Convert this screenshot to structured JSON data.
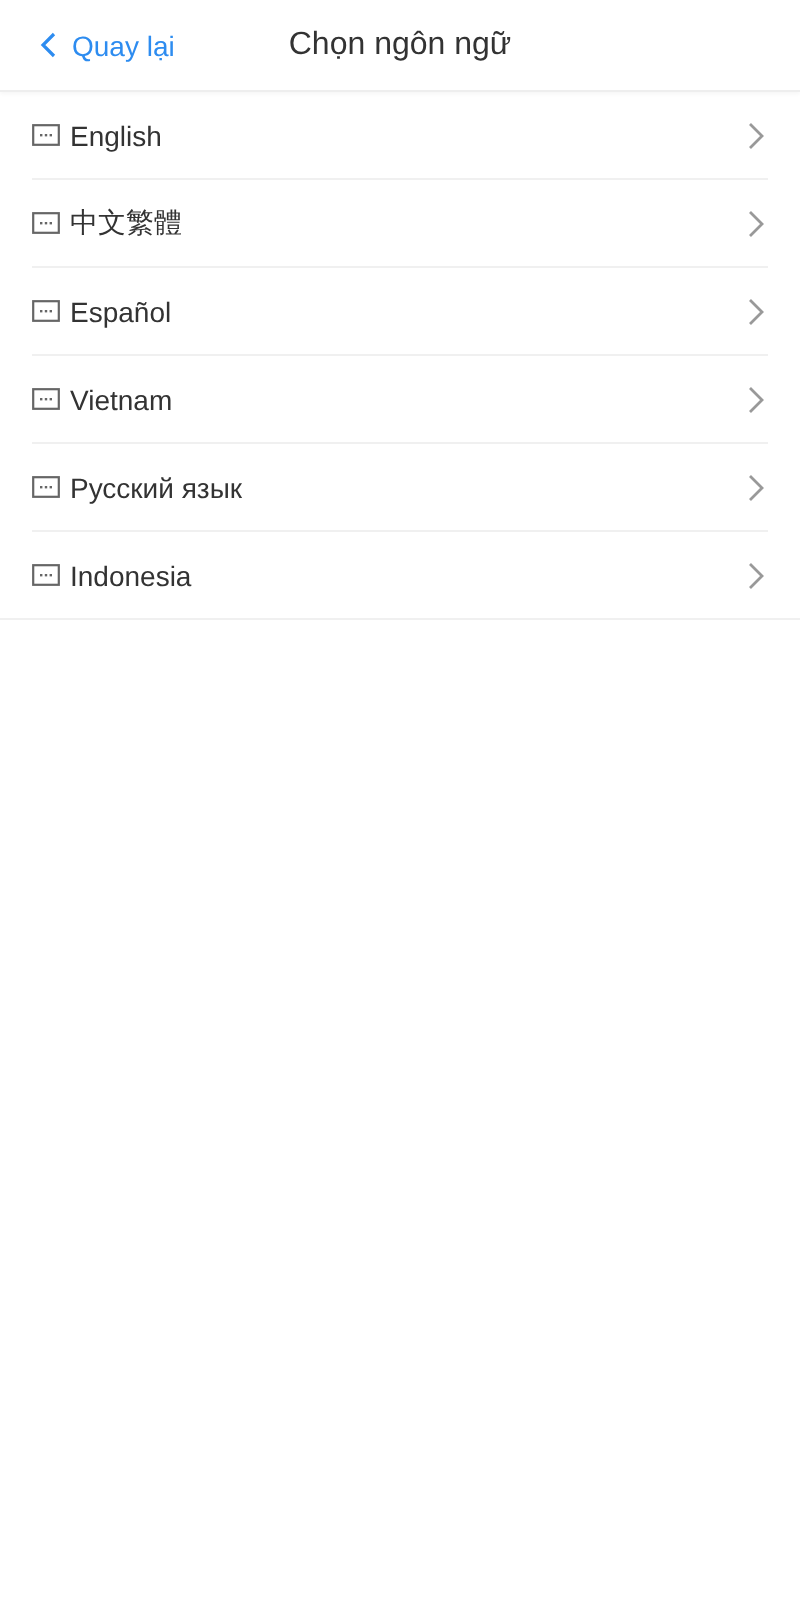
{
  "header": {
    "back": "Quay lại",
    "title": "Chọn ngôn ngữ"
  },
  "languages": [
    {
      "label": "English"
    },
    {
      "label": "中文繁體"
    },
    {
      "label": "Español"
    },
    {
      "label": "Vietnam"
    },
    {
      "label": "Русский язык"
    },
    {
      "label": "Indonesia"
    }
  ]
}
